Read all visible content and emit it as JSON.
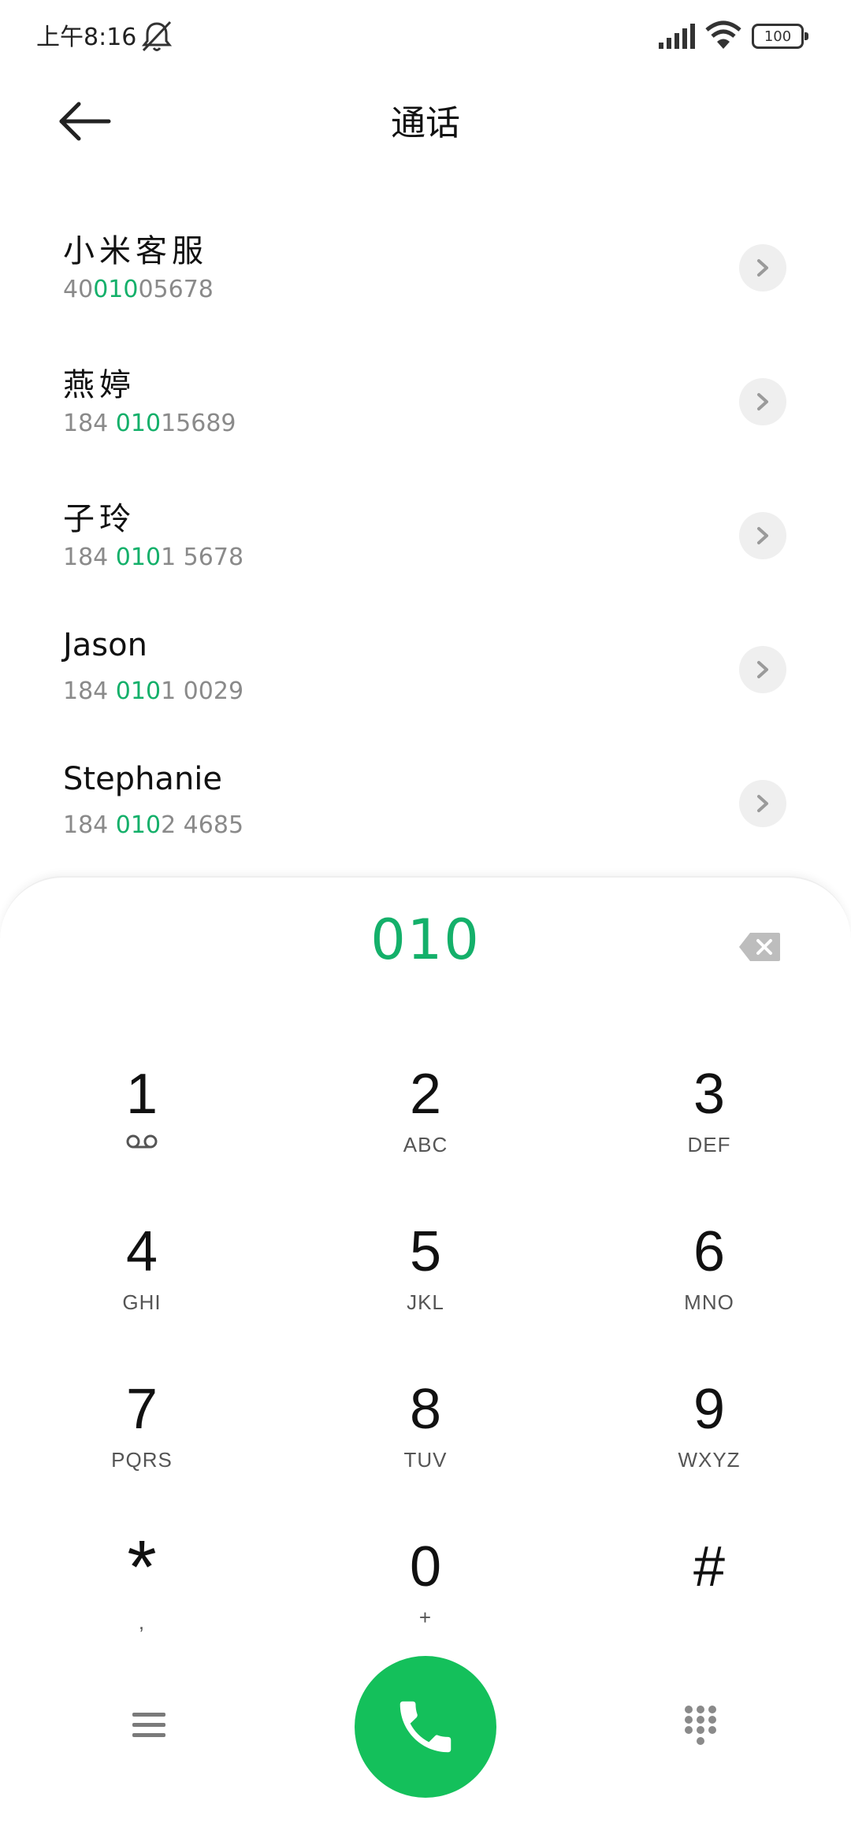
{
  "status_bar": {
    "time": "上午8:16",
    "battery": "100",
    "icons": [
      "mute-icon",
      "signal-icon",
      "wifi-icon",
      "battery-icon"
    ]
  },
  "header": {
    "title": "通话",
    "back_icon": "arrow-left-icon"
  },
  "contacts": [
    {
      "name": "小米客服",
      "num_pre": "40",
      "num_hl": "010",
      "num_post": "05678"
    },
    {
      "name": "燕婷",
      "num_pre": "184 ",
      "num_hl": "010",
      "num_post": "15689"
    },
    {
      "name": "子玲",
      "num_pre": "184 ",
      "num_hl": "010",
      "num_post": "1 5678"
    },
    {
      "name": "Jason",
      "num_pre": "184 ",
      "num_hl": "010",
      "num_post": "1 0029"
    },
    {
      "name": "Stephanie",
      "num_pre": "184 ",
      "num_hl": "010",
      "num_post": "2 4685"
    }
  ],
  "dialer": {
    "dialed_number": "010",
    "keys": [
      {
        "digit": "1",
        "letters": ""
      },
      {
        "digit": "2",
        "letters": "ABC"
      },
      {
        "digit": "3",
        "letters": "DEF"
      },
      {
        "digit": "4",
        "letters": "GHI"
      },
      {
        "digit": "5",
        "letters": "JKL"
      },
      {
        "digit": "6",
        "letters": "MNO"
      },
      {
        "digit": "7",
        "letters": "PQRS"
      },
      {
        "digit": "8",
        "letters": "TUV"
      },
      {
        "digit": "9",
        "letters": "WXYZ"
      },
      {
        "digit": "*",
        "letters": ","
      },
      {
        "digit": "0",
        "letters": "+"
      },
      {
        "digit": "#",
        "letters": ""
      }
    ]
  },
  "colors": {
    "accent_green": "#14b06a",
    "call_button": "#14c05b",
    "secondary_text": "#8a8a8a"
  }
}
